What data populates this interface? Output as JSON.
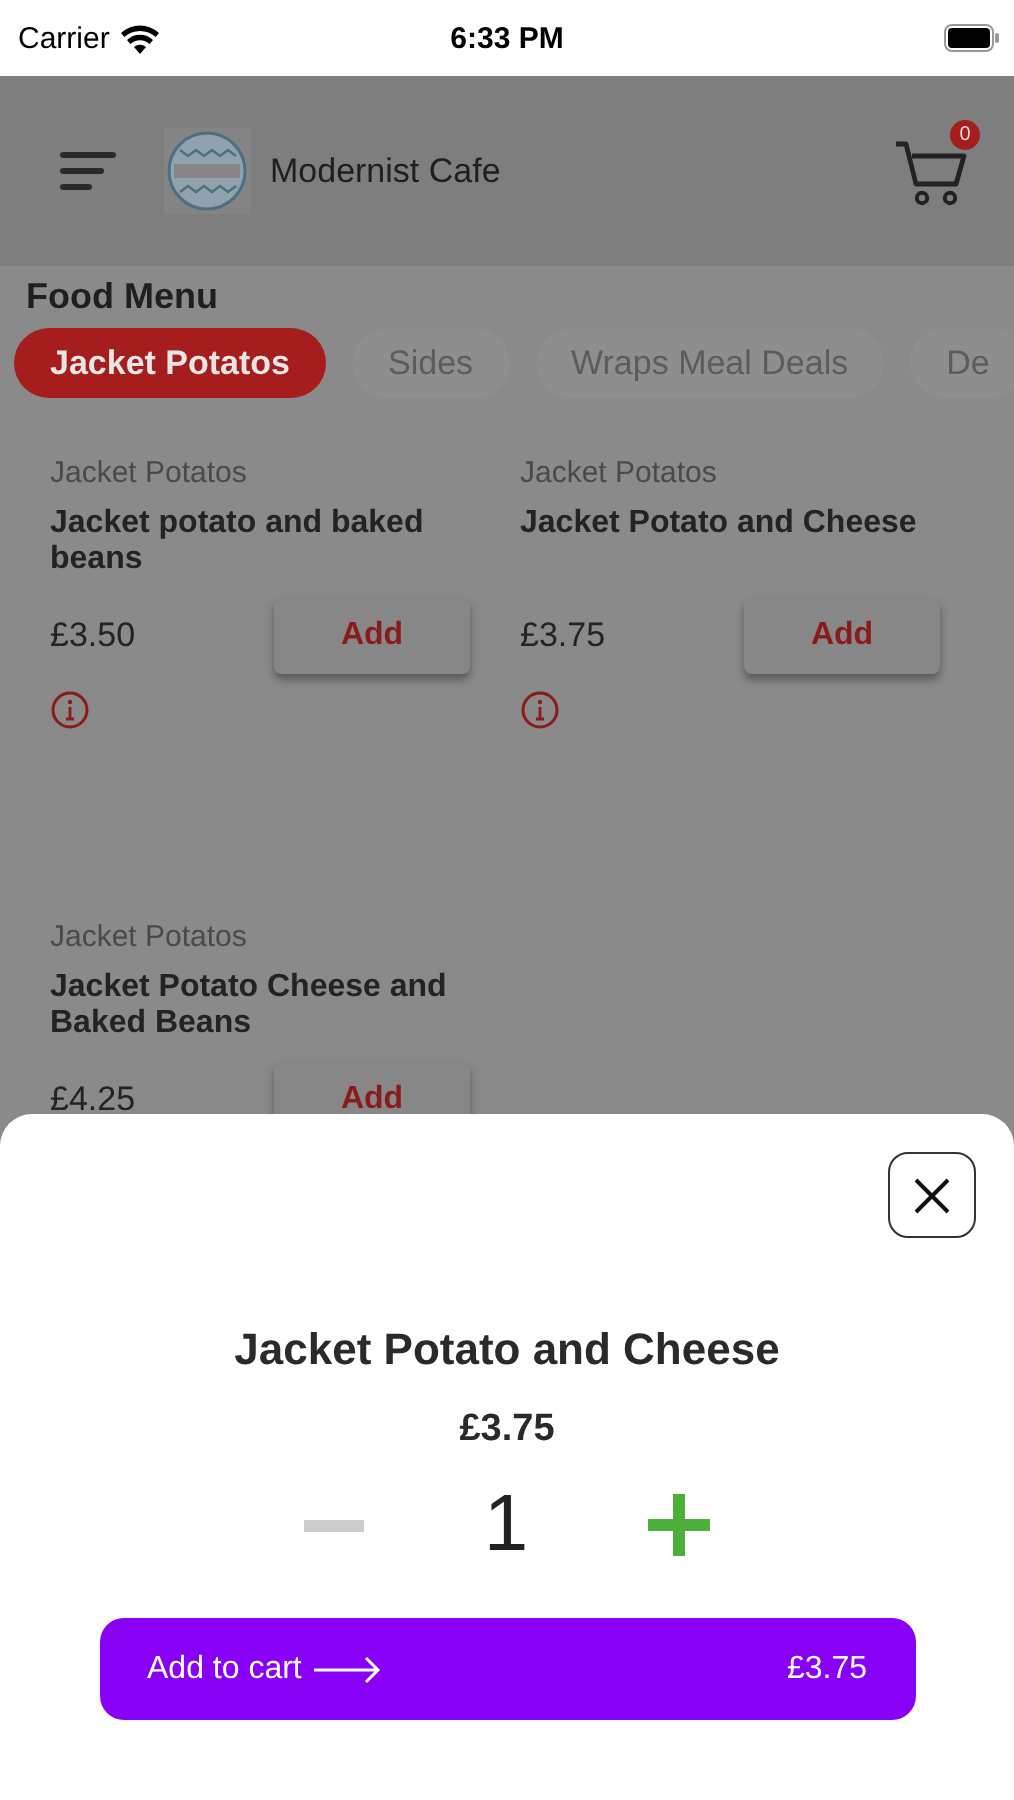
{
  "status_bar": {
    "carrier": "Carrier",
    "time": "6:33 PM"
  },
  "header": {
    "title": "Modernist Cafe",
    "cart_count": "0"
  },
  "section_title": "Food Menu",
  "tabs": [
    {
      "label": "Jacket Potatos",
      "selected": true
    },
    {
      "label": "Sides",
      "selected": false
    },
    {
      "label": "Wraps Meal Deals",
      "selected": false
    },
    {
      "label": "De",
      "selected": false
    }
  ],
  "items": [
    {
      "category": "Jacket Potatos",
      "name": "Jacket potato and baked beans",
      "price": "£3.50",
      "button": "Add",
      "info": true
    },
    {
      "category": "Jacket Potatos",
      "name": "Jacket Potato and Cheese",
      "price": "£3.75",
      "button": "Add",
      "info": true
    },
    {
      "category": "Jacket Potatos",
      "name": "Jacket Potato Cheese and Baked Beans",
      "price": "£4.25",
      "button": "Add",
      "info": false
    }
  ],
  "sheet": {
    "title": "Jacket Potato and Cheese",
    "price": "£3.75",
    "quantity": "1",
    "minus_disabled": true,
    "button": {
      "label": "Add to cart",
      "price": "£3.75"
    }
  }
}
